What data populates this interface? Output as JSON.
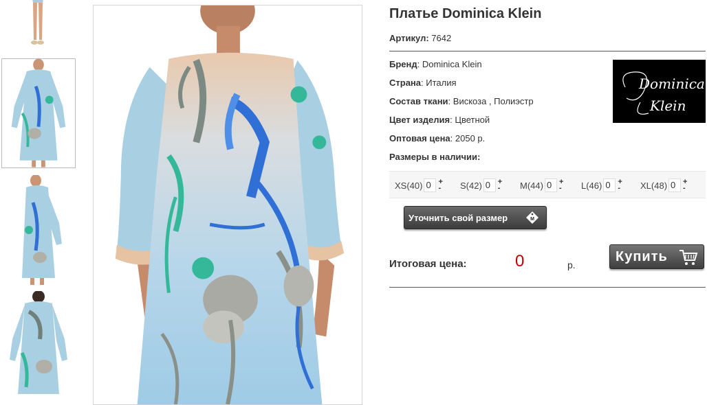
{
  "product": {
    "title": "Платье Dominica Klein",
    "article_label": "Артикул:",
    "article_value": "7642"
  },
  "details": {
    "brand_label": "Бренд",
    "brand_value": "Dominica Klein",
    "country_label": "Страна",
    "country_value": "Италия",
    "fabric_label": "Состав ткани",
    "fabric_value": "Вискоза , Полиэстр",
    "color_label": "Цвет изделия",
    "color_value": "Цветной",
    "price_label": "Оптовая цена",
    "price_value": "2050 р.",
    "sizes_label": "Размеры в наличии:"
  },
  "brand_logo": {
    "line1": "Dominica",
    "line2": "Klein"
  },
  "sizes": [
    {
      "label": "XS(40)",
      "qty": "0"
    },
    {
      "label": "S(42)",
      "qty": "0"
    },
    {
      "label": "M(44)",
      "qty": "0"
    },
    {
      "label": "L(46)",
      "qty": "0"
    },
    {
      "label": "XL(48)",
      "qty": "0"
    }
  ],
  "stepper": {
    "plus": "+",
    "minus": "-"
  },
  "size_button": {
    "label": "Уточнить свой размер",
    "tag": "M"
  },
  "total": {
    "label": "Итоговая цена:",
    "value": "0",
    "currency": "р."
  },
  "buy_button": {
    "label": "Купить"
  },
  "icons": {
    "size_tag": "size-tag-icon",
    "cart": "shopping-cart-icon"
  },
  "colors": {
    "price_red": "#c00000",
    "button_dark": "#3e3e3e",
    "dress_blue": "#a9cfe3",
    "dress_teal": "#35b89a",
    "iris_blue": "#2f6fd6"
  }
}
